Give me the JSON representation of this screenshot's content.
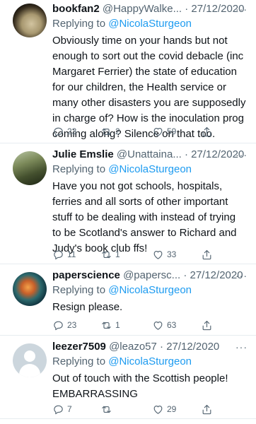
{
  "tweets": [
    {
      "name": "bookfan2",
      "handle": "@HappyWalke...",
      "date": "· 27/12/2020",
      "more": "···",
      "replying_prefix": "Replying to",
      "replying_to": "@NicolaSturgeon",
      "text": "Obviously time on your hands but not enough to sort out the covid debacle (inc Margaret Ferrier) the state of education for our children, the Health service or many other disasters you are supposedly in charge of? How is the inoculation prog coming along? Silence on that too.",
      "replies": "23",
      "retweets": "2",
      "likes": "59"
    },
    {
      "name": "Julie Emslie",
      "handle": "@Unattaina...",
      "date": "· 27/12/2020",
      "more": "···",
      "replying_prefix": "Replying to",
      "replying_to": "@NicolaSturgeon",
      "text": "Have you not got schools, hospitals, ferries and all sorts of other important stuff to be dealing with instead of trying to be Scotland's answer to Richard and Judy's book club ffs!",
      "replies": "11",
      "retweets": "1",
      "likes": "33"
    },
    {
      "name": "paperscience",
      "handle": "@papersc...",
      "date": "· 27/12/2020",
      "more": "···",
      "replying_prefix": "Replying to",
      "replying_to": "@NicolaSturgeon",
      "text": "Resign please.",
      "replies": "23",
      "retweets": "1",
      "likes": "63"
    },
    {
      "name": "leezer7509",
      "handle": "@leazo57",
      "date": "· 27/12/2020",
      "more": "···",
      "replying_prefix": "Replying to",
      "replying_to": "@NicolaSturgeon",
      "text": "Out of touch with the Scottish people! EMBARRASSING",
      "replies": "7",
      "retweets": "",
      "likes": "29"
    }
  ],
  "icons": {
    "reply": "reply-icon",
    "retweet": "retweet-icon",
    "like": "heart-icon",
    "share": "share-icon",
    "more": "more-icon"
  },
  "colors": {
    "text": "#0f1419",
    "secondary": "#536471",
    "link": "#1d9bf0",
    "divider": "#e6ecf0"
  }
}
